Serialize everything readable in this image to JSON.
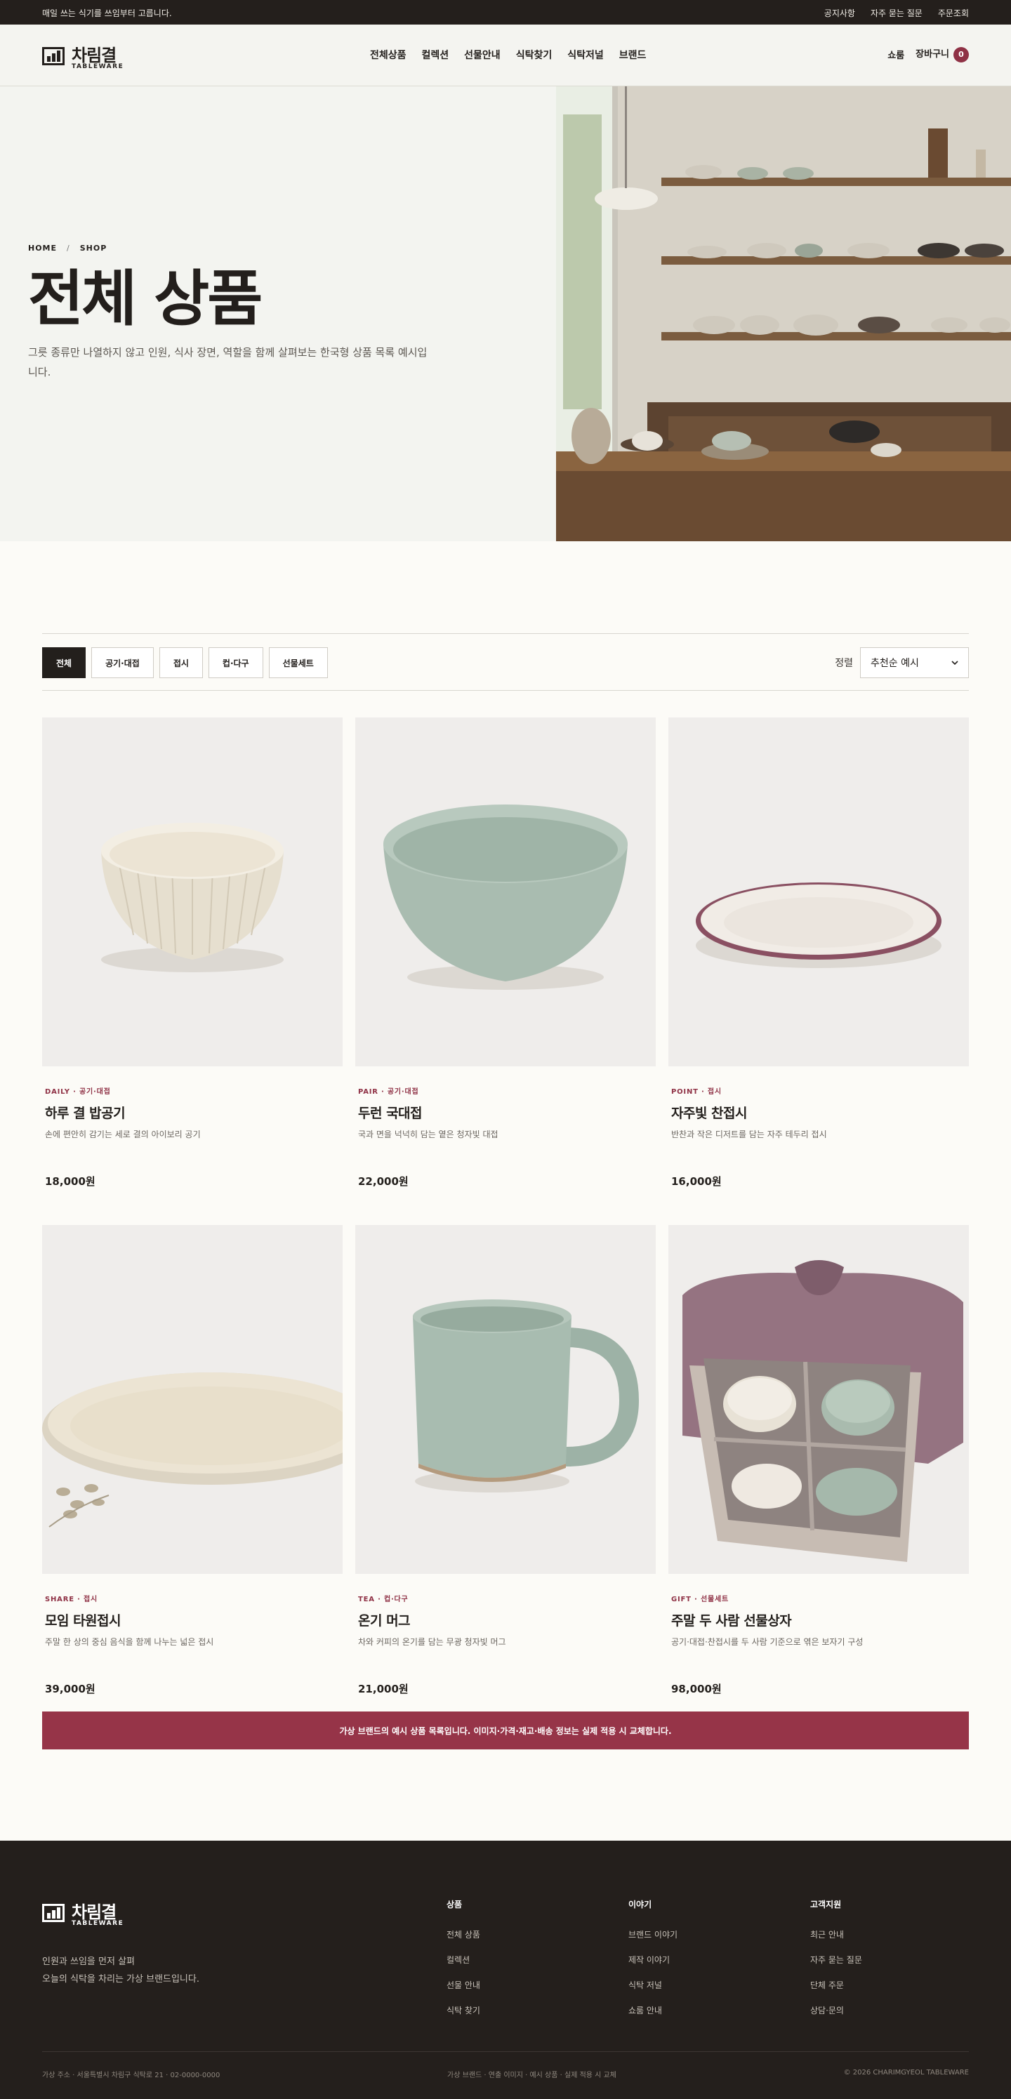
{
  "topbar": {
    "notice": "매일 쓰는 식기를 쓰임부터 고릅니다.",
    "links": [
      "공지사항",
      "자주 묻는 질문",
      "주문조회"
    ]
  },
  "brand": {
    "name": "차림결",
    "sub": "TABLEWARE"
  },
  "nav": {
    "items": [
      "전체상품",
      "컬렉션",
      "선물안내",
      "식탁찾기",
      "식탁저널",
      "브랜드"
    ]
  },
  "header_right": {
    "showroom": "쇼룸",
    "cart": "장바구니",
    "cart_count": "0"
  },
  "hero": {
    "breadcrumb": [
      "HOME",
      "/",
      "SHOP"
    ],
    "title": "전체 상품",
    "description": "그릇 종류만 나열하지 않고 인원, 식사 장면, 역할을 함께 살펴보는 한국형 상품 목록 예시입니다."
  },
  "filters": {
    "chips": [
      "전체",
      "공기·대접",
      "접시",
      "컵·다구",
      "선물세트"
    ],
    "active": "전체",
    "sort_label": "정렬",
    "sort_value": "추천순 예시"
  },
  "products": [
    {
      "category": "DAILY · 공기·대접",
      "name": "하루 결 밥공기",
      "desc": "손에 편안히 감기는 세로 결의 아이보리 공기",
      "price": "18,000원"
    },
    {
      "category": "PAIR · 공기·대접",
      "name": "두런 국대접",
      "desc": "국과 면을 넉넉히 담는 옅은 청자빛 대접",
      "price": "22,000원"
    },
    {
      "category": "POINT · 접시",
      "name": "자주빛 찬접시",
      "desc": "반찬과 작은 디저트를 담는 자주 테두리 접시",
      "price": "16,000원"
    },
    {
      "category": "SHARE · 접시",
      "name": "모임 타원접시",
      "desc": "주말 한 상의 중심 음식을 함께 나누는 넓은 접시",
      "price": "39,000원"
    },
    {
      "category": "TEA · 컵·다구",
      "name": "온기 머그",
      "desc": "차와 커피의 온기를 담는 무광 청자빛 머그",
      "price": "21,000원"
    },
    {
      "category": "GIFT · 선물세트",
      "name": "주말 두 사람 선물상자",
      "desc": "공기·대접·찬접시를 두 사람 기준으로 엮은 보자기 구성",
      "price": "98,000원"
    }
  ],
  "banner": "가상 브랜드의 예시 상품 목록입니다. 이미지·가격·재고·배송 정보는 실제 적용 시 교체합니다.",
  "footer": {
    "about": [
      "인원과 쓰임을 먼저 살펴",
      "오늘의 식탁을 차리는 가상 브랜드입니다."
    ],
    "columns": [
      {
        "title": "상품",
        "links": [
          "전체 상품",
          "컬렉션",
          "선물 안내",
          "식탁 찾기"
        ]
      },
      {
        "title": "이야기",
        "links": [
          "브랜드 이야기",
          "제작 이야기",
          "식탁 저널",
          "쇼룸 안내"
        ]
      },
      {
        "title": "고객지원",
        "links": [
          "최근 안내",
          "자주 묻는 질문",
          "단체 주문",
          "상담·문의"
        ]
      }
    ],
    "address": "가상 주소 · 서울특별시 차림구 식탁로 21 · 02-0000-0000",
    "disclaimer": "가상 브랜드 · 연출 이미지 · 예시 상품 · 실제 적용 시 교체",
    "copyright": "© 2026 CHARIMGYEOL TABLEWARE"
  }
}
